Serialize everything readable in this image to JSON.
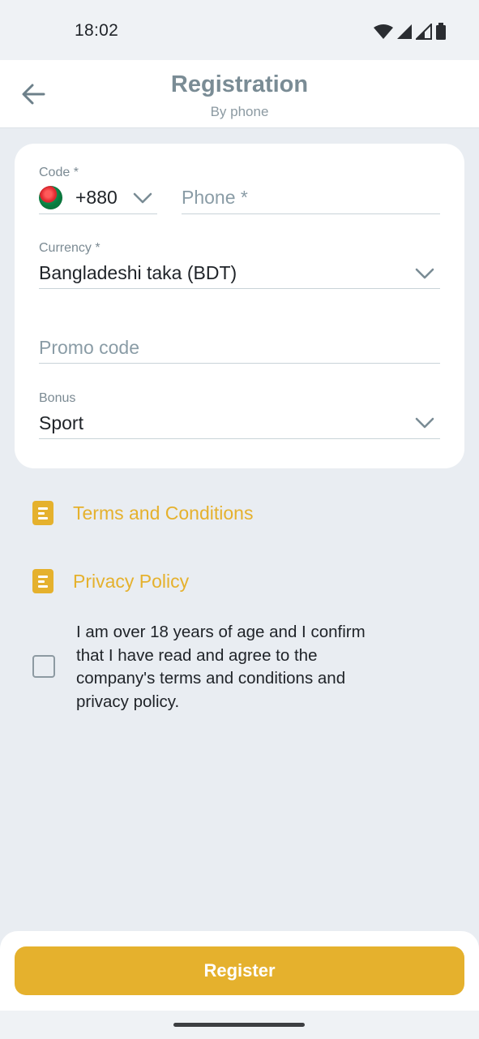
{
  "status_bar": {
    "time": "18:02",
    "icons": [
      "wifi-icon",
      "signal-icon",
      "signal-weak-icon",
      "battery-icon"
    ]
  },
  "header": {
    "title": "Registration",
    "subtitle": "By phone",
    "back_icon": "arrow-left-icon"
  },
  "form": {
    "code": {
      "label": "Code *",
      "value": "+880",
      "flag": "bangladesh-flag"
    },
    "phone": {
      "placeholder": "Phone *"
    },
    "currency": {
      "label": "Currency *",
      "value": "Bangladeshi taka (BDT)"
    },
    "promo": {
      "placeholder": "Promo code"
    },
    "bonus": {
      "label": "Bonus",
      "value": "Sport"
    }
  },
  "links": {
    "terms": "Terms and Conditions",
    "privacy": "Privacy Policy"
  },
  "agreement": {
    "text": "I am over 18 years of age and I confirm that I have read and agree to the company's terms and conditions and privacy policy.",
    "checked": false
  },
  "actions": {
    "register_label": "Register"
  },
  "colors": {
    "accent": "#e5b12d",
    "background": "#e9edf2",
    "card": "#ffffff",
    "muted_text": "#7b8a93"
  }
}
